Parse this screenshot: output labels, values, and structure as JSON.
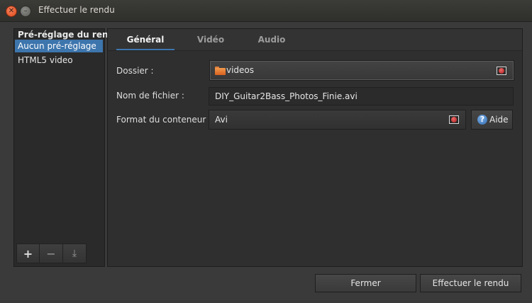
{
  "window": {
    "title": "Effectuer le rendu"
  },
  "presets": {
    "header": "Pré-réglage du rendu",
    "items": [
      {
        "label": "Aucun pré-réglage",
        "selected": true
      },
      {
        "label": "HTML5 video",
        "selected": false
      }
    ],
    "toolbar": {
      "add": "+",
      "remove": "−",
      "save": "⤓"
    }
  },
  "tabs": [
    {
      "label": "Général",
      "active": true
    },
    {
      "label": "Vidéo",
      "active": false
    },
    {
      "label": "Audio",
      "active": false
    }
  ],
  "general": {
    "folder_label": "Dossier :",
    "folder_value": "videos",
    "filename_label": "Nom de fichier :",
    "filename_value": "DIY_Guitar2Bass_Photos_Finie.avi",
    "container_label": "Format du conteneur :",
    "container_value": "Avi",
    "help_label": "Aide",
    "help_icon": "?"
  },
  "buttons": {
    "close": "Fermer",
    "render": "Effectuer le rendu"
  },
  "colors": {
    "accent": "#3d75ad",
    "close_button": "#e4572b",
    "folder": "#f0893a"
  }
}
